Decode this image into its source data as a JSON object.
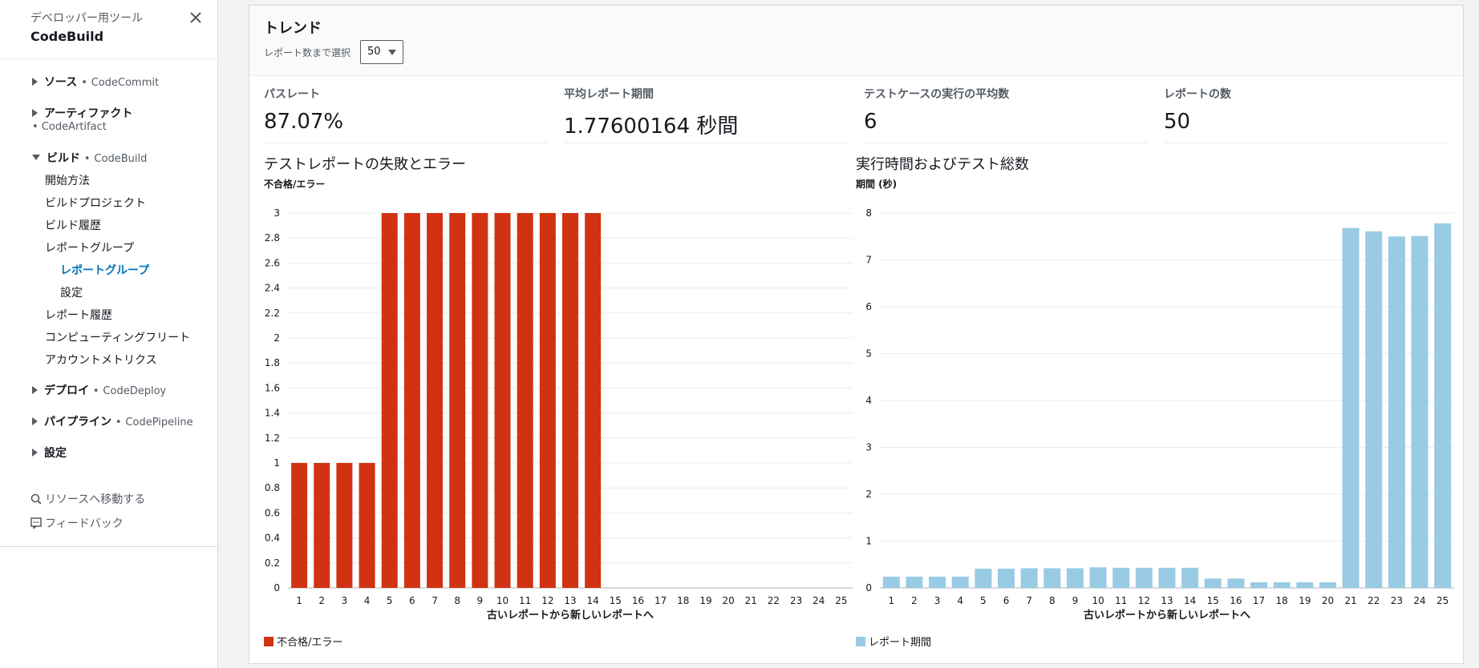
{
  "sidebar": {
    "supertitle": "デベロッパー用ツール",
    "title": "CodeBuild",
    "close_icon": "close-icon",
    "sections": [
      {
        "label": "ソース",
        "service": "CodeCommit"
      },
      {
        "label": "アーティファクト",
        "service": "CodeArtifact"
      },
      {
        "label": "ビルド",
        "service": "CodeBuild"
      },
      {
        "label": "デプロイ",
        "service": "CodeDeploy"
      },
      {
        "label": "パイプライン",
        "service": "CodePipeline"
      },
      {
        "label": "設定",
        "service": ""
      }
    ],
    "separator": "•",
    "build_items": [
      "開始方法",
      "ビルドプロジェクト",
      "ビルド履歴",
      "レポートグループ",
      "レポートグループ",
      "設定",
      "レポート履歴",
      "コンピューティングフリート",
      "アカウントメトリクス"
    ],
    "goto_resource": "リソースへ移動する",
    "feedback": "フィードバック"
  },
  "trends": {
    "title": "トレンド",
    "select_label": "レポート数まで選択",
    "select_value": "50"
  },
  "metrics": [
    {
      "label": "パスレート",
      "value": "87.07%"
    },
    {
      "label": "平均レポート期間",
      "value": "1.77600164 秒間"
    },
    {
      "label": "テストケースの実行の平均数",
      "value": "6"
    },
    {
      "label": "レポートの数",
      "value": "50"
    }
  ],
  "chart_data": [
    {
      "type": "bar",
      "title": "テストレポートの失敗とエラー",
      "ylabel": "不合格/エラー",
      "xlabel": "古いレポートから新しいレポートへ",
      "categories": [
        "1",
        "2",
        "3",
        "4",
        "5",
        "6",
        "7",
        "8",
        "9",
        "10",
        "11",
        "12",
        "13",
        "14",
        "15",
        "16",
        "17",
        "18",
        "19",
        "20",
        "21",
        "22",
        "23",
        "24",
        "25"
      ],
      "series": [
        {
          "name": "不合格/エラー",
          "values": [
            1,
            1,
            1,
            1,
            3,
            3,
            3,
            3,
            3,
            3,
            3,
            3,
            3,
            3,
            0,
            0,
            0,
            0,
            0,
            0,
            0,
            0,
            0,
            0,
            0
          ]
        }
      ],
      "ylim": [
        0,
        3
      ],
      "yticks": [
        "0",
        "0.2",
        "0.4",
        "0.6",
        "0.8",
        "1",
        "1.2",
        "1.4",
        "1.6",
        "1.8",
        "2",
        "2.2",
        "2.4",
        "2.6",
        "2.8",
        "3"
      ],
      "color": "#d13212",
      "grid": true,
      "legend": "bottom-left"
    },
    {
      "type": "bar",
      "title": "実行時間およびテスト総数",
      "ylabel": "期間 (秒)",
      "xlabel": "古いレポートから新しいレポートへ",
      "categories": [
        "1",
        "2",
        "3",
        "4",
        "5",
        "6",
        "7",
        "8",
        "9",
        "10",
        "11",
        "12",
        "13",
        "14",
        "15",
        "16",
        "17",
        "18",
        "19",
        "20",
        "21",
        "22",
        "23",
        "24",
        "25"
      ],
      "series": [
        {
          "name": "レポート期間",
          "values": [
            0.24,
            0.24,
            0.24,
            0.24,
            0.41,
            0.41,
            0.42,
            0.42,
            0.42,
            0.44,
            0.43,
            0.43,
            0.43,
            0.43,
            0.2,
            0.2,
            0.12,
            0.12,
            0.12,
            0.12,
            7.68,
            7.61,
            7.5,
            7.51,
            7.78
          ]
        }
      ],
      "ylim": [
        0,
        8
      ],
      "yticks": [
        "0",
        "1",
        "2",
        "3",
        "4",
        "5",
        "6",
        "7",
        "8"
      ],
      "color": "#99cbe4",
      "grid": true,
      "legend": "bottom-left"
    }
  ]
}
